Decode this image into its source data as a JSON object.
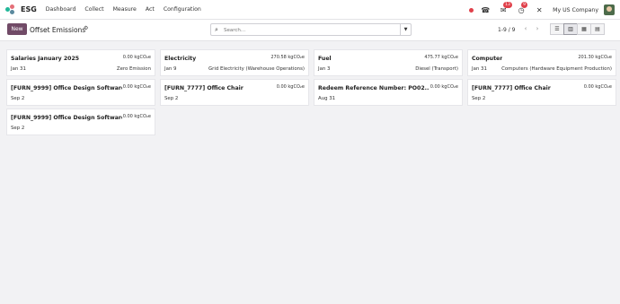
{
  "navbar": {
    "app_name": "ESG",
    "menu": [
      "Dashboard",
      "Collect",
      "Measure",
      "Act",
      "Configuration"
    ],
    "phone_icon": "phone-icon",
    "messages_badge": "13",
    "activity_badge": "9",
    "company": "My US Company"
  },
  "controls": {
    "new_label": "New",
    "title": "Offset Emissions",
    "search_placeholder": "Search...",
    "pager_text": "1-9 / 9"
  },
  "cards": [
    {
      "title": "Salaries January 2025",
      "amount": "0.00 kgCO₂e",
      "date": "Jan 31",
      "source": "Zero Emission"
    },
    {
      "title": "Electricity",
      "amount": "270.58 kgCO₂e",
      "date": "Jan 9",
      "source": "Grid Electricity (Warehouse Operations)"
    },
    {
      "title": "Fuel",
      "amount": "475.77 kgCO₂e",
      "date": "Jan 3",
      "source": "Diesel (Transport)"
    },
    {
      "title": "Computer",
      "amount": "201.30 kgCO₂e",
      "date": "Jan 31",
      "source": "Computers (Hardware Equipment Production)"
    },
    {
      "title": "[FURN_9999] Office Design Software",
      "amount": "0.00 kgCO₂e",
      "date": "Sep 2",
      "source": ""
    },
    {
      "title": "[FURN_7777] Office Chair",
      "amount": "0.00 kgCO₂e",
      "date": "Sep 2",
      "source": ""
    },
    {
      "title": "Redeem Reference Number: PO02...",
      "amount": "0.00 kgCO₂e",
      "date": "Aug 31",
      "source": ""
    },
    {
      "title": "[FURN_7777] Office Chair",
      "amount": "0.00 kgCO₂e",
      "date": "Sep 2",
      "source": ""
    },
    {
      "title": "[FURN_9999] Office Design Software",
      "amount": "0.00 kgCO₂e",
      "date": "Sep 2",
      "source": ""
    }
  ]
}
